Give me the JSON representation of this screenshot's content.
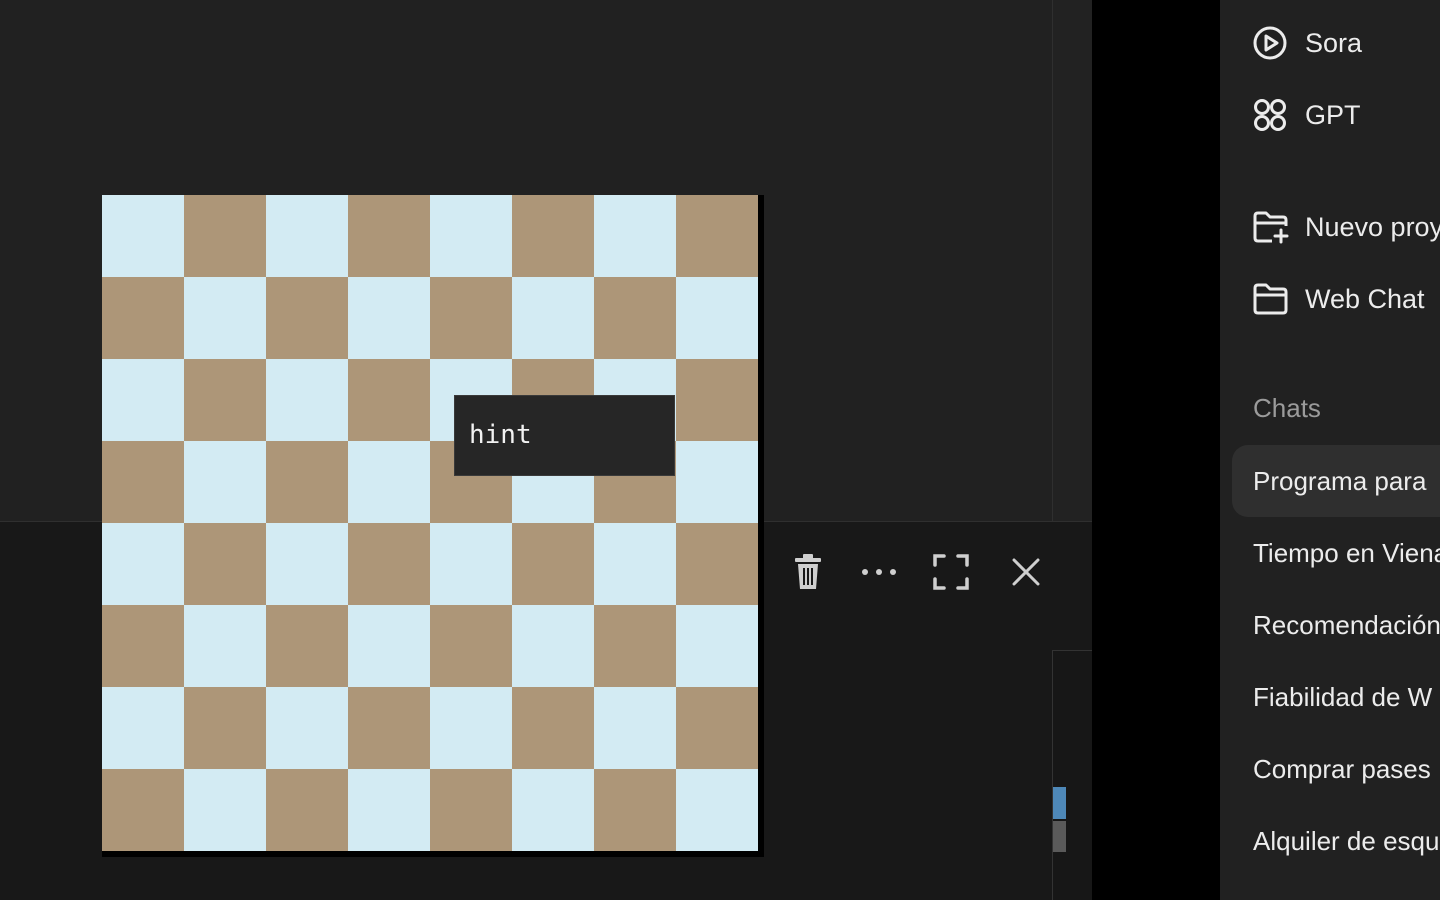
{
  "board": {
    "rows": 8,
    "cols": 8,
    "colors": {
      "light": "#d3ebf3",
      "dark": "#ad9678"
    }
  },
  "tooltip": {
    "text": "hint"
  },
  "toolbar": {
    "buttons": [
      {
        "icon": "trash-icon"
      },
      {
        "icon": "more-icon"
      },
      {
        "icon": "fullscreen-icon"
      },
      {
        "icon": "close-icon"
      }
    ]
  },
  "sidebar": {
    "nav": [
      {
        "label": "Sora",
        "icon": "play-circle-icon"
      },
      {
        "label": "GPT",
        "icon": "grid-circles-icon"
      },
      {
        "label": "Nuevo proyecto",
        "icon": "folder-plus-icon"
      },
      {
        "label": "Web Chat",
        "icon": "folder-icon"
      }
    ],
    "section_label": "Chats",
    "chats": [
      {
        "label": "Programa para",
        "active": true
      },
      {
        "label": "Tiempo en Viena",
        "active": false
      },
      {
        "label": "Recomendación",
        "active": false
      },
      {
        "label": "Fiabilidad de W",
        "active": false
      },
      {
        "label": "Comprar pases",
        "active": false
      },
      {
        "label": "Alquiler de esquís",
        "active": false
      }
    ]
  }
}
